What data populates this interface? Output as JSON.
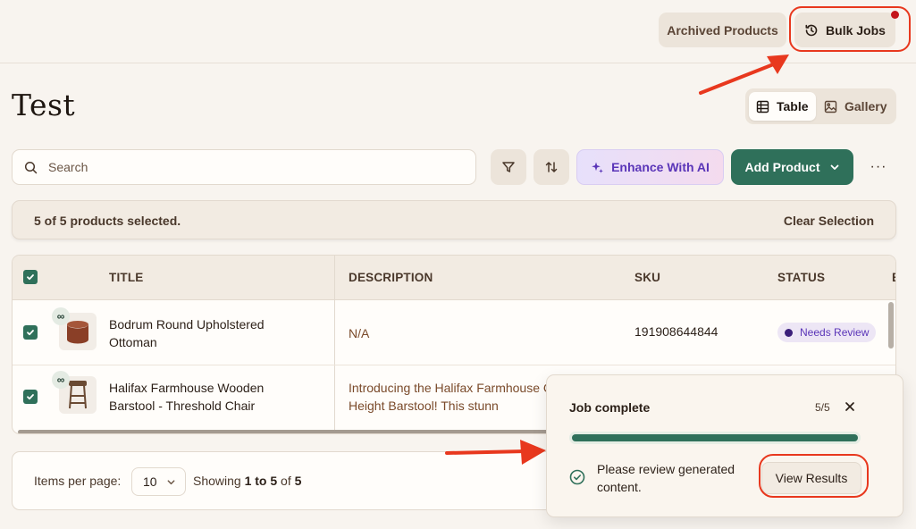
{
  "header": {
    "archived_label": "Archived Products",
    "bulk_jobs_label": "Bulk Jobs"
  },
  "page": {
    "title": "Test"
  },
  "view_toggle": {
    "table_label": "Table",
    "gallery_label": "Gallery",
    "active": "table"
  },
  "toolbar": {
    "search_placeholder": "Search",
    "search_value": "",
    "enhance_label": "Enhance With AI",
    "add_product_label": "Add Product",
    "more_label": "···"
  },
  "selection": {
    "text": "5 of 5 products selected.",
    "clear_label": "Clear Selection"
  },
  "table": {
    "columns": [
      "TITLE",
      "DESCRIPTION",
      "SKU",
      "STATUS",
      "B"
    ],
    "rows": [
      {
        "title": "Bodrum Round Upholstered Ottoman",
        "description": "N/A",
        "sku": "191908644844",
        "status": "Needs Review",
        "badge": "∞",
        "image": "ottoman-thumbnail"
      },
      {
        "title": "Halifax Farmhouse Wooden Barstool - Threshold Chair",
        "description": "Introducing the Halifax Farmhouse Counter Height Barstool! This stunn",
        "sku": "",
        "status": "",
        "badge": "∞",
        "image": "barstool-thumbnail"
      }
    ]
  },
  "footer": {
    "items_per_page_label": "Items per page:",
    "items_per_page_value": "10",
    "showing_prefix": "Showing ",
    "showing_range": "1 to 5",
    "showing_of": " of ",
    "showing_total": "5"
  },
  "job_toast": {
    "title": "Job complete",
    "count": "5/5",
    "progress_fraction": 1.0,
    "message": "Please review generated content.",
    "view_results_label": "View Results"
  },
  "colors": {
    "accent_green": "#2f705a",
    "annotation_red": "#e8381e",
    "notification_red": "#c4161c",
    "status_purple": "#5a35b8"
  }
}
